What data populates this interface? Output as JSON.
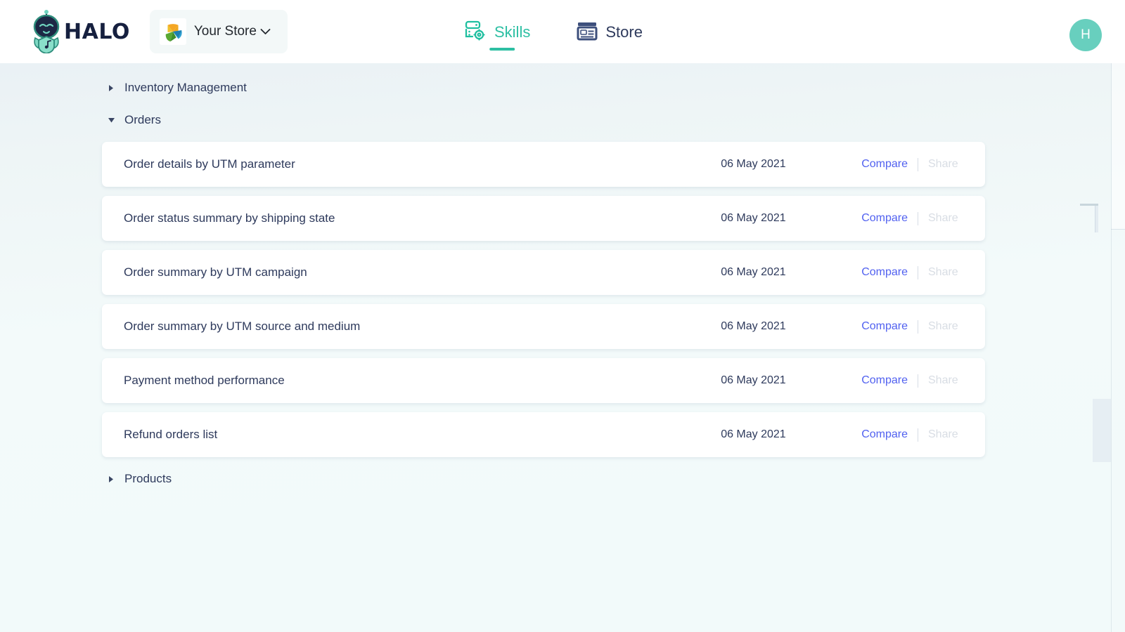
{
  "brand": {
    "name": "HALO",
    "logo_icon": "halo-robot-logo"
  },
  "store_selector": {
    "label": "Your Store",
    "logo_icon": "store-pinwheel-logo",
    "chevron_icon": "chevron-down-icon"
  },
  "nav": {
    "items": [
      {
        "label": "Skills",
        "icon": "skills-server-gear-icon",
        "active": true
      },
      {
        "label": "Store",
        "icon": "store-window-icon",
        "active": false
      }
    ]
  },
  "account": {
    "avatar_initial": "H",
    "avatar_color": "#68cfbe"
  },
  "colors": {
    "accent_teal": "#2dbfa3",
    "link_blue": "#5161f0",
    "text_navy": "#2e3a5c",
    "disabled_grey": "#d8dde4",
    "card_white": "#ffffff"
  },
  "tree": {
    "collapsed_above": {
      "label": "Inventory Management",
      "caret_icon": "caret-right-icon",
      "expanded": false
    },
    "expanded_group": {
      "label": "Orders",
      "caret_icon": "caret-down-icon",
      "expanded": true
    },
    "collapsed_below": {
      "label": "Products",
      "caret_icon": "caret-right-icon",
      "expanded": false
    }
  },
  "actions": {
    "compare_label": "Compare",
    "share_label": "Share"
  },
  "reports": [
    {
      "title": "Order details by UTM parameter",
      "date": "06 May 2021"
    },
    {
      "title": "Order status summary by shipping state",
      "date": "06 May 2021"
    },
    {
      "title": "Order summary by UTM campaign",
      "date": "06 May 2021"
    },
    {
      "title": "Order summary by UTM source and medium",
      "date": "06 May 2021"
    },
    {
      "title": "Payment method performance",
      "date": "06 May 2021"
    },
    {
      "title": "Refund orders list",
      "date": "06 May 2021"
    }
  ]
}
